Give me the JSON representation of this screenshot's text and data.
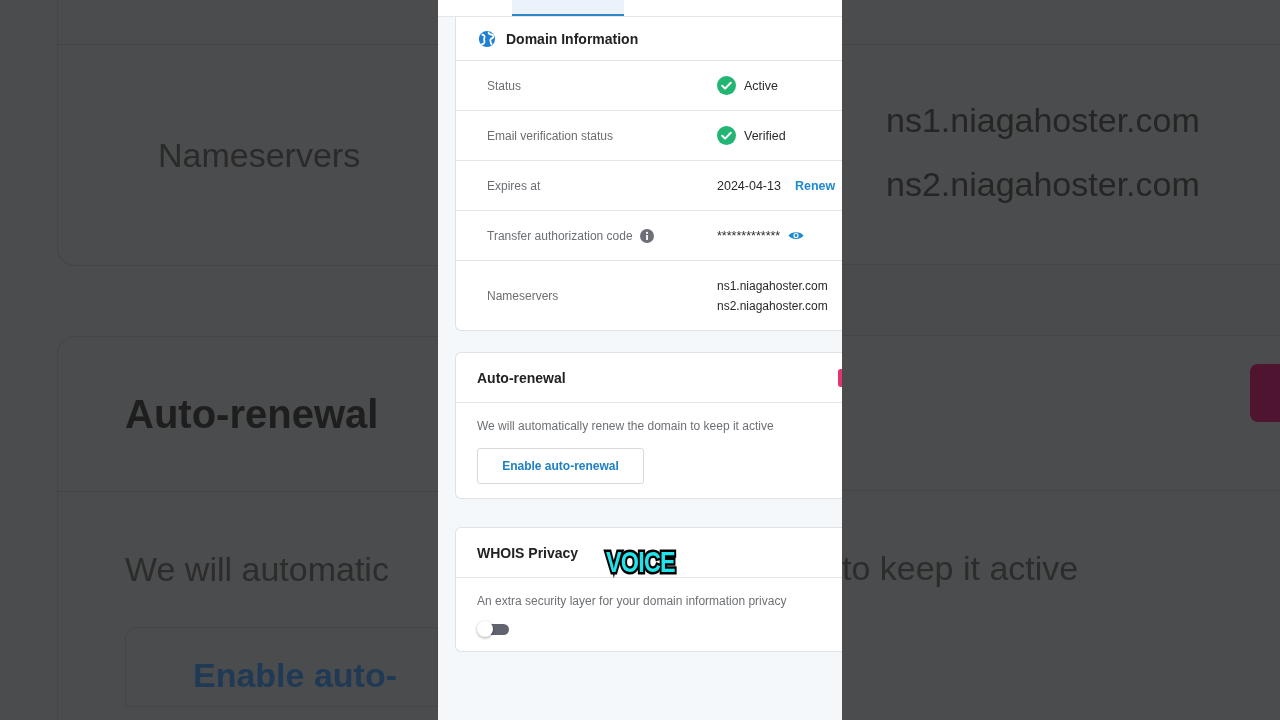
{
  "backdrop": {
    "left": {
      "nameservers_label": "Nameservers",
      "auto_renewal_title": "Auto-renewal",
      "description": "We will automatic",
      "button": "Enable auto-"
    },
    "right": {
      "nameservers": [
        "ns1.niagahoster.com",
        "ns2.niagahoster.com"
      ],
      "description": "to keep it active"
    }
  },
  "tab_strip": {
    "tabs": [
      {
        "selected": false
      },
      {
        "selected": true
      },
      {
        "selected": false
      }
    ]
  },
  "domain_information": {
    "title": "Domain Information",
    "rows": [
      {
        "label": "Status",
        "kind": "status",
        "value": "Active"
      },
      {
        "label": "Email verification status",
        "kind": "status",
        "value": "Verified"
      },
      {
        "label": "Expires at",
        "kind": "date",
        "value": "2024-04-13",
        "link": "Renew"
      },
      {
        "label": "Transfer authorization code",
        "kind": "secret",
        "value": "*************"
      },
      {
        "label": "Nameservers",
        "kind": "list",
        "values": [
          "ns1.niagahoster.com",
          "ns2.niagahoster.com"
        ]
      }
    ]
  },
  "auto_renewal": {
    "title": "Auto-renewal",
    "description": "We will automatically renew the domain to keep it active",
    "button": "Enable auto-renewal"
  },
  "whois_privacy": {
    "title": "WHOIS Privacy",
    "description": "An extra security layer for your domain information privacy",
    "enabled": false
  },
  "caption": "VOICE"
}
